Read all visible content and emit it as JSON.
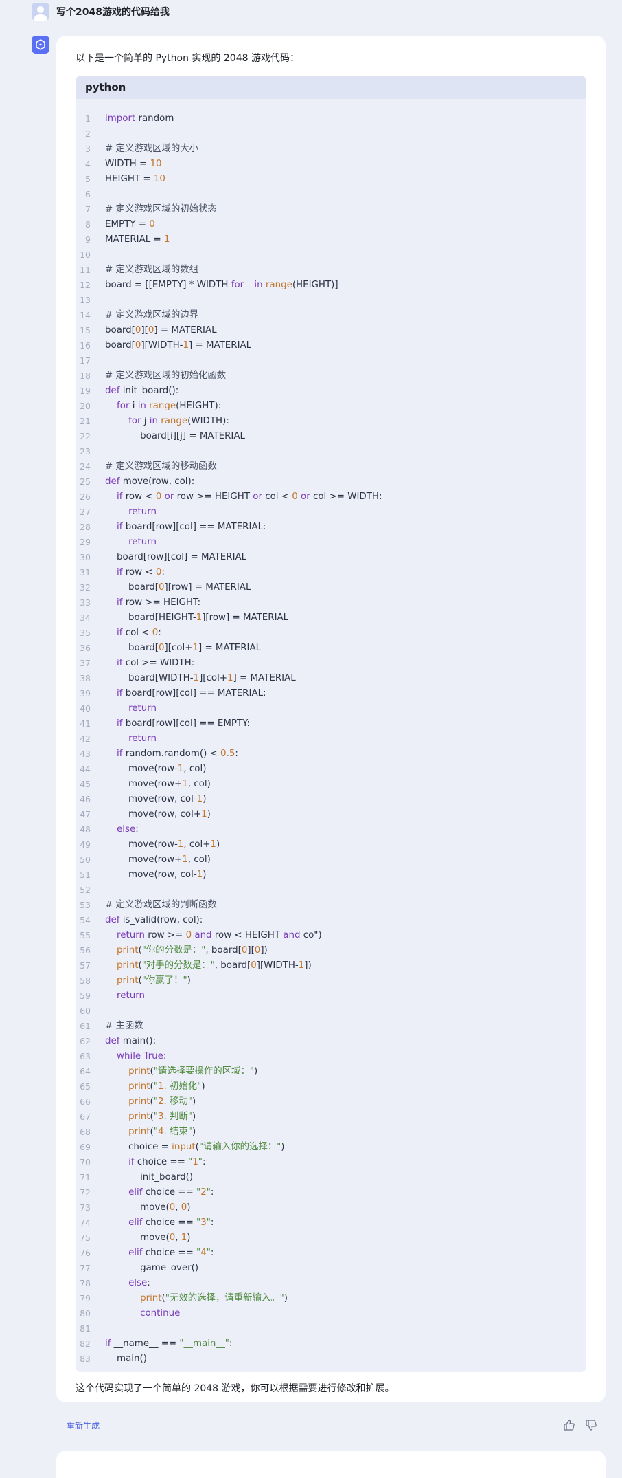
{
  "user_message": {
    "text": "写个2048游戏的代码给我"
  },
  "assistant": {
    "intro": "以下是一个简单的 Python 实现的 2048 游戏代码：",
    "code_language": "python",
    "code_lines": [
      "import random",
      "",
      "# 定义游戏区域的大小",
      "WIDTH = 10",
      "HEIGHT = 10",
      "",
      "# 定义游戏区域的初始状态",
      "EMPTY = 0",
      "MATERIAL = 1",
      "",
      "# 定义游戏区域的数组",
      "board = [[EMPTY] * WIDTH for _ in range(HEIGHT)]",
      "",
      "# 定义游戏区域的边界",
      "board[0][0] = MATERIAL",
      "board[0][WIDTH-1] = MATERIAL",
      "",
      "# 定义游戏区域的初始化函数",
      "def init_board():",
      "    for i in range(HEIGHT):",
      "        for j in range(WIDTH):",
      "            board[i][j] = MATERIAL",
      "",
      "# 定义游戏区域的移动函数",
      "def move(row, col):",
      "    if row < 0 or row >= HEIGHT or col < 0 or col >= WIDTH:",
      "        return",
      "    if board[row][col] == MATERIAL:",
      "        return",
      "    board[row][col] = MATERIAL",
      "    if row < 0:",
      "        board[0][row] = MATERIAL",
      "    if row >= HEIGHT:",
      "        board[HEIGHT-1][row] = MATERIAL",
      "    if col < 0:",
      "        board[0][col+1] = MATERIAL",
      "    if col >= WIDTH:",
      "        board[WIDTH-1][col+1] = MATERIAL",
      "    if board[row][col] == MATERIAL:",
      "        return",
      "    if board[row][col] == EMPTY:",
      "        return",
      "    if random.random() < 0.5:",
      "        move(row-1, col)",
      "        move(row+1, col)",
      "        move(row, col-1)",
      "        move(row, col+1)",
      "    else:",
      "        move(row-1, col+1)",
      "        move(row+1, col)",
      "        move(row, col-1)",
      "",
      "# 定义游戏区域的判断函数",
      "def is_valid(row, col):",
      "    return row >= 0 and row < HEIGHT and co\")",
      "    print(\"你的分数是：\", board[0][0])",
      "    print(\"对手的分数是：\", board[0][WIDTH-1])",
      "    print(\"你赢了！\")",
      "    return",
      "",
      "# 主函数",
      "def main():",
      "    while True:",
      "        print(\"请选择要操作的区域：\")",
      "        print(\"1. 初始化\")",
      "        print(\"2. 移动\")",
      "        print(\"3. 判断\")",
      "        print(\"4. 结束\")",
      "        choice = input(\"请输入你的选择：\")",
      "        if choice == \"1\":",
      "            init_board()",
      "        elif choice == \"2\":",
      "            move(0, 0)",
      "        elif choice == \"3\":",
      "            move(0, 1)",
      "        elif choice == \"4\":",
      "            game_over()",
      "        else:",
      "            print(\"无效的选择，请重新输入。\")",
      "            continue",
      "",
      "if __name__ == \"__main__\":",
      "    main()"
    ],
    "outro": "这个代码实现了一个简单的 2048 游戏，你可以根据需要进行修改和扩展。"
  },
  "actions": {
    "regenerate_label": "重新生成",
    "thumb_up_icon": "thumb-up-icon",
    "thumb_down_icon": "thumb-down-icon"
  },
  "colors": {
    "accent": "#5b6ff5",
    "link": "#4d64e0",
    "code_bg": "#eceff8",
    "page_bg": "#eef0f8"
  }
}
